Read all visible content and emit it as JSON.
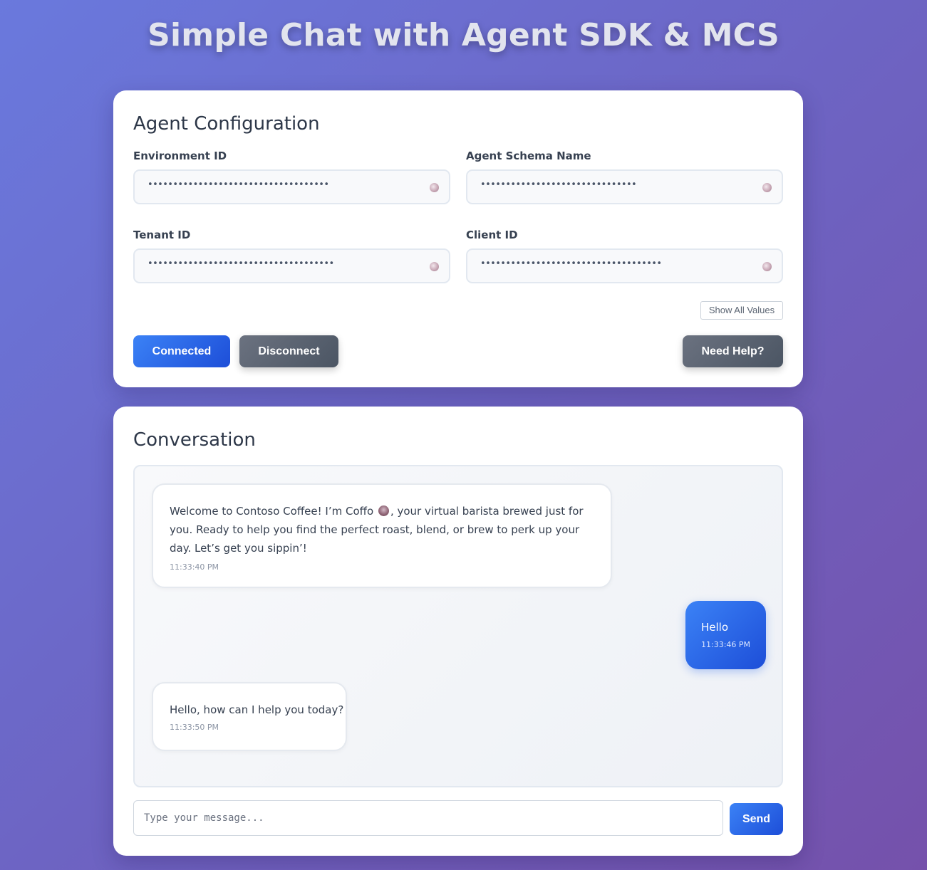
{
  "app": {
    "title": "Simple Chat with Agent SDK & MCS"
  },
  "config": {
    "title": "Agent Configuration",
    "fields": [
      {
        "label": "Environment ID",
        "value": "••••••••••••••••••••••••••••••••••••"
      },
      {
        "label": "Agent Schema Name",
        "value": "•••••••••••••••••••••••••••••••"
      },
      {
        "label": "Tenant ID",
        "value": "•••••••••••••••••••••••••••••••••••••"
      },
      {
        "label": "Client ID",
        "value": "••••••••••••••••••••••••••••••••••••"
      }
    ],
    "show_all_label": "Show All Values",
    "connected_label": "Connected",
    "disconnect_label": "Disconnect",
    "help_label": "Need Help?"
  },
  "conversation": {
    "title": "Conversation",
    "messages": [
      {
        "role": "agent",
        "text_before_icon": "Welcome to Contoso Coffee! I’m Coffo",
        "icon": "coffee-icon",
        "text_after_icon": ", your virtual barista brewed just for you. Ready to help you find the perfect roast, blend, or brew to perk up your day. Let’s get you sippin’!",
        "time": "11:33:40 PM"
      },
      {
        "role": "user",
        "text": "Hello",
        "time": "11:33:46 PM"
      },
      {
        "role": "agent",
        "text": "Hello, how can I help you today?",
        "time": "11:33:50 PM"
      }
    ],
    "input_placeholder": "Type your message...",
    "input_value": "",
    "send_label": "Send"
  },
  "colors": {
    "background_gradient_start": "#6a79dd",
    "background_gradient_end": "#7551ab",
    "primary_blue": "#3b82f6",
    "primary_blue_dark": "#1d4ed8",
    "secondary_gray": "#6b7280"
  }
}
